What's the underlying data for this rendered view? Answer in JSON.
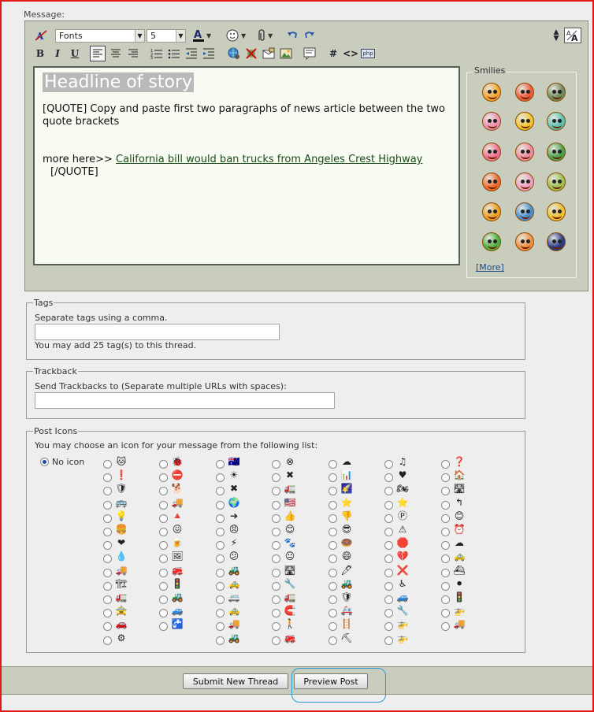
{
  "message_label": "Message:",
  "toolbar": {
    "font_select": "Fonts",
    "size_select": "5",
    "bold": "B",
    "italic": "I",
    "underline": "U",
    "hash": "#",
    "code": "<>",
    "php": "php"
  },
  "editor": {
    "headline": "Headline of story",
    "body": "[QUOTE] Copy and paste first two paragraphs of news article between the two quote brackets",
    "more_prefix": "more here>> ",
    "more_link": "California bill would ban trucks from Angeles Crest Highway",
    "close_quote": "[/QUOTE]"
  },
  "smilies": {
    "title": "Smilies",
    "more_link": "[More]",
    "colors": [
      "#f6a530",
      "#ef5a3a",
      "#6e8a5a",
      "#f08fb0",
      "#f5c430",
      "#5ec0b0",
      "#f07090",
      "#f08aa0",
      "#4aa04a",
      "#f06a30",
      "#f0a0c0",
      "#a0c050",
      "#f0a020",
      "#4a90d0",
      "#f0c030",
      "#50b040",
      "#f09040",
      "#2a3a8a"
    ]
  },
  "tags": {
    "legend": "Tags",
    "hint": "Separate tags using a comma.",
    "value": "",
    "note": "You may add 25 tag(s) to this thread."
  },
  "trackback": {
    "legend": "Trackback",
    "hint": "Send Trackbacks to (Separate multiple URLs with spaces):",
    "value": ""
  },
  "post_icons": {
    "legend": "Post Icons",
    "hint": "You may choose an icon for your message from the following list:",
    "no_icon_label": "No icon",
    "columns": [
      [
        "🐱",
        "❗",
        "🛡",
        "🚌",
        "💡",
        "🍔",
        "❤",
        "💧",
        "🚚",
        "🏗",
        "🚛",
        "🚖",
        "🚗",
        "⚙"
      ],
      [
        "🐞",
        "⛔",
        "🐕",
        "🚚",
        "🔺",
        "😖",
        "🍺",
        "🖼",
        "🚒",
        "🚦",
        "🚜",
        "🚙",
        "🚰"
      ],
      [
        "🇦🇺",
        "☀",
        "✖",
        "🌍",
        "➔",
        "😠",
        "⚡",
        "😕",
        "🚜",
        "🚕",
        "🚐",
        "🚕",
        "🚚",
        "🚜"
      ],
      [
        "⊗",
        "✖",
        "🚛",
        "🇺🇸",
        "👍",
        "😊",
        "🐾",
        "😐",
        "🛣",
        "🔧",
        "🚛",
        "🧲",
        "🚶",
        "🚒"
      ],
      [
        "☁",
        "📊",
        "🌠",
        "⭐",
        "👎",
        "😎",
        "🍩",
        "😄",
        "🖊",
        "🚜",
        "🛡",
        "🚑",
        "🪜",
        "⛏"
      ],
      [
        "♫",
        "♥",
        "🏍",
        "⭐",
        "Ⓟ",
        "⚠",
        "🛑",
        "💔",
        "❌",
        "♿",
        "🚙",
        "🔧",
        "🚁",
        "🚁"
      ],
      [
        "❓",
        "🏠",
        "🛣",
        "↰",
        "😊",
        "⏰",
        "☁",
        "🚕",
        "⛴",
        "⚫",
        "🚦",
        "🚁",
        "🚚"
      ]
    ]
  },
  "buttons": {
    "submit": "Submit New Thread",
    "preview": "Preview Post"
  }
}
